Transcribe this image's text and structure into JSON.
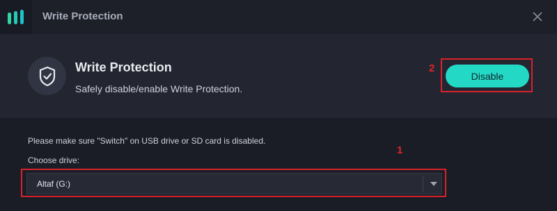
{
  "window": {
    "title": "Write Protection",
    "logo_icon": "app-logo-icon",
    "close_icon": "close-icon"
  },
  "feature": {
    "title": "Write Protection",
    "description": "Safely disable/enable Write Protection.",
    "icon": "shield-check-icon",
    "action_label": "Disable",
    "marker": "2"
  },
  "form": {
    "notice": "Please make sure \"Switch\" on USB drive or SD card is disabled.",
    "choose_label": "Choose drive:",
    "selected_drive": "Altaf (G:)",
    "marker": "1",
    "dropdown_icon": "chevron-down-icon"
  },
  "colors": {
    "accent": "#23d9c6",
    "highlight": "#d9222a",
    "header_bg": "#232631",
    "body_bg": "#1a1d26"
  }
}
